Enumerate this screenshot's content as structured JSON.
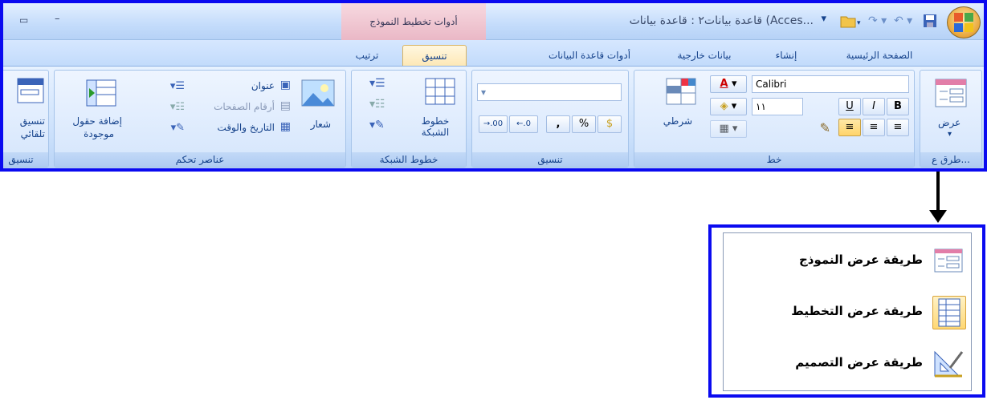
{
  "titlebar": {
    "title": "قاعدة بيانات٢ : قاعدة بيانات (Acces...",
    "contextual_tools": "أدوات تخطيط النموذج"
  },
  "tabs": [
    {
      "label": "الصفحة الرئيسية"
    },
    {
      "label": "إنشاء"
    },
    {
      "label": "بيانات خارجية"
    },
    {
      "label": "أدوات قاعدة البيانات"
    },
    {
      "label": "تنسيق",
      "active": true
    },
    {
      "label": "ترتيب"
    }
  ],
  "groups": {
    "views": {
      "label": "طرق ع...",
      "view_button": "عرض"
    },
    "font": {
      "label": "خط",
      "font_name": "Calibri",
      "font_size": "١١",
      "bold": "B",
      "italic": "I",
      "underline": "U"
    },
    "conditional": {
      "label": "شرطي"
    },
    "formatting": {
      "label": "تنسيق",
      "percent": "%",
      "comma": ",",
      "inc_decimal": "→.00",
      "dec_decimal": "←.0"
    },
    "gridlines": {
      "label": "خطوط الشبكة",
      "gridlines_button": "خطوط الشبكة"
    },
    "controls": {
      "label": "عناصر تحكم",
      "logo": "شعار",
      "title": "عنوان",
      "page_numbers": "أرقام الصفحات",
      "date_time": "التاريخ والوقت",
      "add_fields_line1": "إضافة حقول",
      "add_fields_line2": "موجودة"
    },
    "autoformat": {
      "label": "تنسيق",
      "button_line1": "تنسيق",
      "button_line2": "تلقائي"
    }
  },
  "view_menu": {
    "items": [
      {
        "label": "طريقة عرض النموذج",
        "icon": "form-view-icon"
      },
      {
        "label": "طريقة عرض التخطيط",
        "icon": "layout-view-icon",
        "selected": true
      },
      {
        "label": "طريقة عرض التصميم",
        "icon": "design-view-icon"
      }
    ]
  },
  "colors": {
    "frame": "#0a0af0",
    "ribbon": "#bfdbff",
    "text": "#15428b",
    "active_tab": "#fde8b6"
  }
}
